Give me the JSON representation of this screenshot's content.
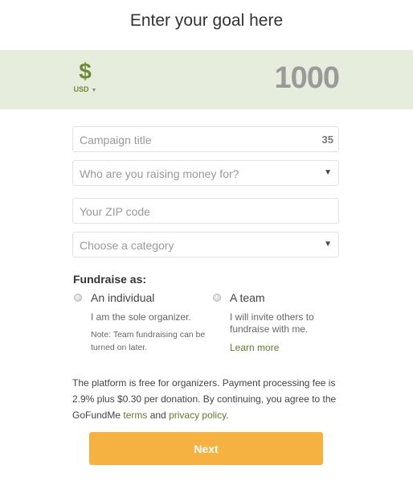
{
  "header": {
    "title": "Enter your goal here"
  },
  "goal": {
    "currency_symbol": "$",
    "currency_code": "USD",
    "currency_caret": "▼",
    "amount": "1000"
  },
  "form": {
    "campaign_title": {
      "placeholder": "Campaign title",
      "char_count": "35"
    },
    "raising_for": {
      "placeholder": "Who are you raising money for?",
      "arrow": "▼"
    },
    "zip": {
      "placeholder": "Your ZIP code"
    },
    "category": {
      "placeholder": "Choose a category",
      "arrow": "▼"
    }
  },
  "fundraise_as": {
    "label": "Fundraise as:",
    "individual": {
      "title": "An individual",
      "desc": "I am the sole organizer.",
      "note": "Note: Team fundraising can be turned on later."
    },
    "team": {
      "title": "A team",
      "desc": "I will invite others to fundraise with me.",
      "learn_more": "Learn more"
    }
  },
  "legal": {
    "text_before": "The platform is free for organizers. Payment processing fee is 2.9% plus $0.30 per donation. By continuing, you agree to the GoFundMe ",
    "terms": "terms",
    "and": " and ",
    "privacy": "privacy policy",
    "end": "."
  },
  "actions": {
    "next_label": "Next"
  },
  "colors": {
    "accent_green": "#5f7a2e",
    "band": "#e6eddc",
    "button": "#f5b240"
  }
}
